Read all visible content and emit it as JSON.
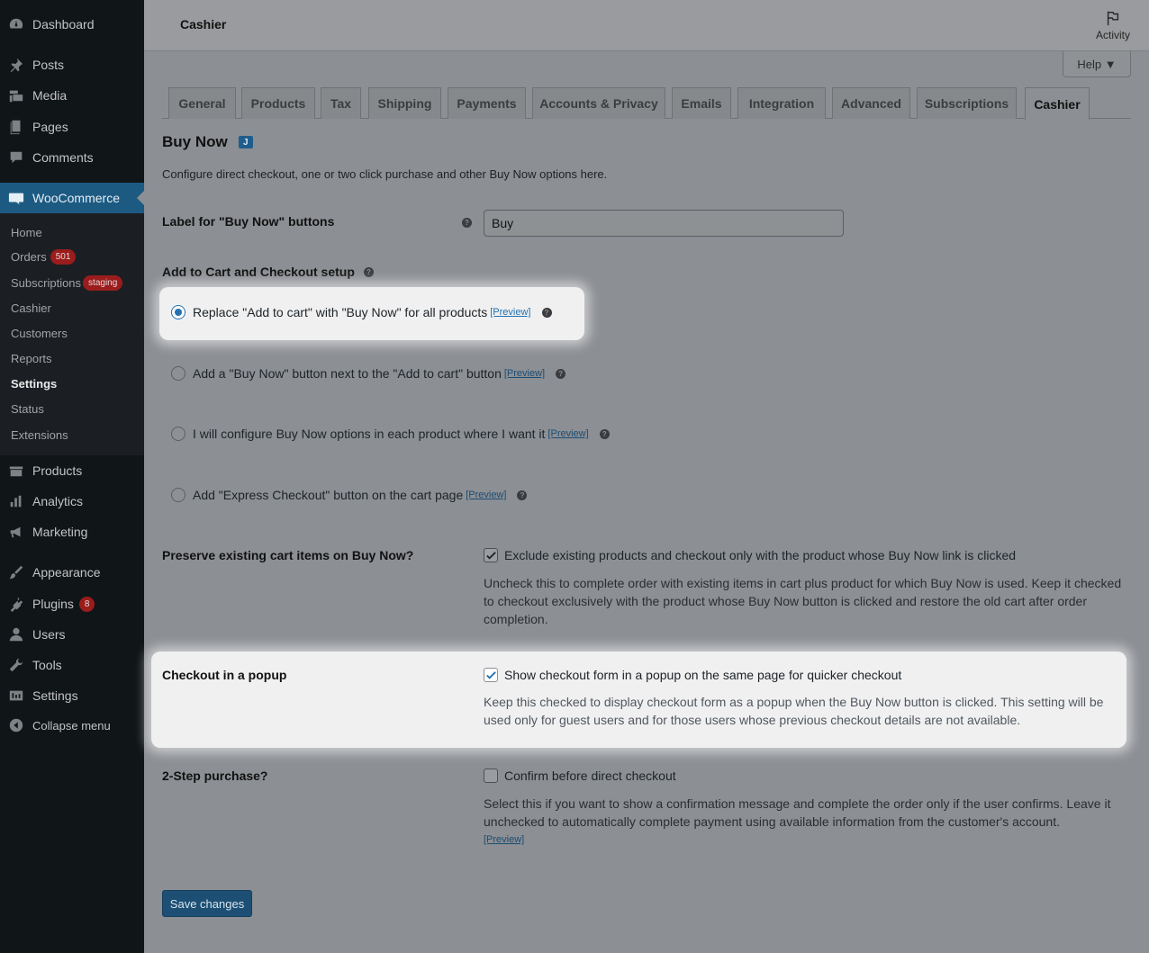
{
  "sidebar": {
    "top_items": [
      {
        "label": "Dashboard",
        "icon": "dashboard-icon"
      },
      {
        "label": "Posts",
        "icon": "pin-icon"
      },
      {
        "label": "Media",
        "icon": "media-icon"
      },
      {
        "label": "Pages",
        "icon": "pages-icon"
      },
      {
        "label": "Comments",
        "icon": "comment-icon"
      },
      {
        "label": "WooCommerce",
        "icon": "woo-icon"
      }
    ],
    "woo_submenu": [
      {
        "label": "Home"
      },
      {
        "label": "Orders",
        "badge": "501"
      },
      {
        "label": "Subscriptions",
        "badge": "staging"
      },
      {
        "label": "Cashier"
      },
      {
        "label": "Customers"
      },
      {
        "label": "Reports"
      },
      {
        "label": "Settings"
      },
      {
        "label": "Status"
      },
      {
        "label": "Extensions"
      }
    ],
    "bottom_items": [
      {
        "label": "Products",
        "icon": "products-icon"
      },
      {
        "label": "Analytics",
        "icon": "analytics-icon"
      },
      {
        "label": "Marketing",
        "icon": "megaphone-icon"
      },
      {
        "label": "Appearance",
        "icon": "brush-icon"
      },
      {
        "label": "Plugins",
        "icon": "plugin-icon",
        "badge": "8"
      },
      {
        "label": "Users",
        "icon": "user-icon"
      },
      {
        "label": "Tools",
        "icon": "wrench-icon"
      },
      {
        "label": "Settings",
        "icon": "settings-icon"
      },
      {
        "label": "Collapse menu",
        "icon": "collapse-icon"
      }
    ]
  },
  "header": {
    "title": "Cashier",
    "activity_label": "Activity",
    "help_label": "Help ▼"
  },
  "tabs": [
    "General",
    "Products",
    "Tax",
    "Shipping",
    "Payments",
    "Accounts & Privacy",
    "Emails",
    "Integration",
    "Advanced",
    "Subscriptions",
    "Cashier"
  ],
  "active_tab": "Cashier",
  "section": {
    "title": "Buy Now",
    "description": "Configure direct checkout, one or two click purchase and other Buy Now options here."
  },
  "label_field": {
    "label": "Label for \"Buy Now\" buttons",
    "value": "Buy"
  },
  "setup": {
    "label": "Add to Cart and Checkout setup",
    "preview_link": "[Preview]",
    "options": [
      {
        "label": "Replace \"Add to cart\" with \"Buy Now\" for all products",
        "checked": true
      },
      {
        "label": "Add a \"Buy Now\" button next to the \"Add to cart\" button",
        "checked": false
      },
      {
        "label": "I will configure Buy Now options in each product where I want it",
        "checked": false
      },
      {
        "label": "Add \"Express Checkout\" button on the cart page",
        "checked": false
      }
    ]
  },
  "preserve": {
    "label": "Preserve existing cart items on Buy Now?",
    "checkbox_label": "Exclude existing products and checkout only with the product whose Buy Now link is clicked",
    "checked": true,
    "help": "Uncheck this to complete order with existing items in cart plus product for which Buy Now is used. Keep it checked to checkout exclusively with the product whose Buy Now button is clicked and restore the old cart after order completion."
  },
  "popup": {
    "label": "Checkout in a popup",
    "checkbox_label": "Show checkout form in a popup on the same page for quicker checkout",
    "checked": true,
    "help": "Keep this checked to display checkout form as a popup when the Buy Now button is clicked. This setting will be used only for guest users and for those users whose previous checkout details are not available."
  },
  "two_step": {
    "label": "2-Step purchase?",
    "checkbox_label": "Confirm before direct checkout",
    "checked": false,
    "help": "Select this if you want to show a confirmation message and complete the order only if the user confirms. Leave it unchecked to automatically complete payment using available information from the customer's account.",
    "preview_link": "[Preview]"
  },
  "save_label": "Save changes",
  "colors": {
    "accent": "#2271b1",
    "sidebar_bg": "#101517",
    "highlight": "#f0f0f1",
    "badge": "#9b1c1c"
  }
}
